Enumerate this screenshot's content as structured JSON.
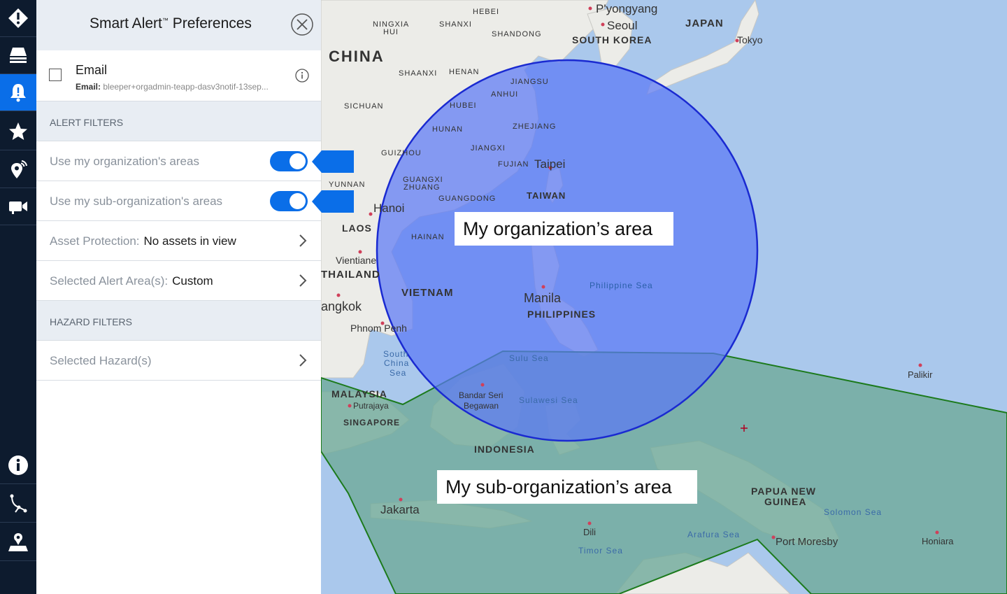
{
  "panel": {
    "title": "Smart Alert",
    "title_mark": "™",
    "title_rest": " Preferences",
    "email": {
      "label": "Email",
      "sub_prefix": "Email:",
      "address": "bleeper+orgadmin-teapp-dasv3notif-13sep..."
    },
    "alert_filters_heading": "ALERT FILTERS",
    "toggles": [
      {
        "label": "Use my organization's areas",
        "on": true
      },
      {
        "label": "Use my sub-organization's areas",
        "on": true
      }
    ],
    "asset_protection": {
      "label": "Asset Protection:",
      "value": "No assets in view"
    },
    "alert_area": {
      "label": "Selected Alert Area(s):",
      "value": "Custom"
    },
    "hazard_filters_heading": "HAZARD FILTERS",
    "hazards": {
      "label": "Selected Hazard(s)"
    }
  },
  "map": {
    "labels": {
      "china": "CHINA",
      "japan": "JAPAN",
      "south_korea": "SOUTH KOREA",
      "pyongyang": "P'yongyang",
      "seoul": "Seoul",
      "tokyo": "Tokyo",
      "hebei": "HEBEI",
      "ningxia": "NINGXIA",
      "ningxia2": "HUI",
      "shanxi": "SHANXI",
      "shandong": "SHANDONG",
      "shaanxi": "SHAANXI",
      "henan": "HENAN",
      "jiangsu": "JIANGSU",
      "anhui": "ANHUI",
      "sichuan": "SICHUAN",
      "hubei": "HUBEI",
      "hunan": "HUNAN",
      "zhejiang": "ZHEJIANG",
      "jiangxi": "JIANGXI",
      "guizhou": "GUIZHOU",
      "fujian": "FUJIAN",
      "taipei": "Taipei",
      "yunnan": "YUNNAN",
      "guangxi": "GUANGXI",
      "guangxi2": "ZHUANG",
      "guangdong": "GUANGDONG",
      "taiwan": "TAIWAN",
      "hanoi": "Hanoi",
      "laos": "LAOS",
      "hainan": "HAINAN",
      "vientiane": "Vientiane",
      "thailand": "THAILAND",
      "vietnam": "VIETNAM",
      "bangkok": "angkok",
      "phnom_penh": "Phnom Penh",
      "manila": "Manila",
      "philippines": "PHILIPPINES",
      "philippine_sea": "Philippine Sea",
      "south": "South",
      "china_sea": "China",
      "sea": "Sea",
      "sulu_sea": "Sulu Sea",
      "bandar": "Bandar Seri",
      "begawan": "Begawan",
      "sulawesi_sea": "Sulawesi Sea",
      "malaysia": "MALAYSIA",
      "putrajaya": "Putrajaya",
      "singapore": "SINGAPORE",
      "indonesia": "INDONESIA",
      "palikir": "Palikir",
      "jakarta": "Jakarta",
      "dili": "Dili",
      "timor_sea": "Timor Sea",
      "arafura_sea": "Arafura Sea",
      "png": "PAPUA NEW",
      "png2": "GUINEA",
      "solomon_sea": "Solomon Sea",
      "port_moresby": "Port Moresby",
      "honiara": "Honiara"
    },
    "colors": {
      "ocean": "#aac8ec",
      "land": "#ecece8",
      "org_area_fill": "#5b79f5",
      "org_area_stroke": "#1a2ad1",
      "sub_org_fill": "#6faa9a",
      "sub_org_stroke": "#1c7a1c",
      "accent": "#0a6ee8"
    }
  },
  "callouts": {
    "org_area": "My organization’s area",
    "sub_org_area": "My sub-organization’s area"
  },
  "icons": [
    "warning-icon",
    "layers-icon",
    "bell-icon",
    "star-icon",
    "location-broadcast-icon",
    "video-camera-icon",
    "info-icon",
    "route-icon",
    "map-pin-icon"
  ]
}
